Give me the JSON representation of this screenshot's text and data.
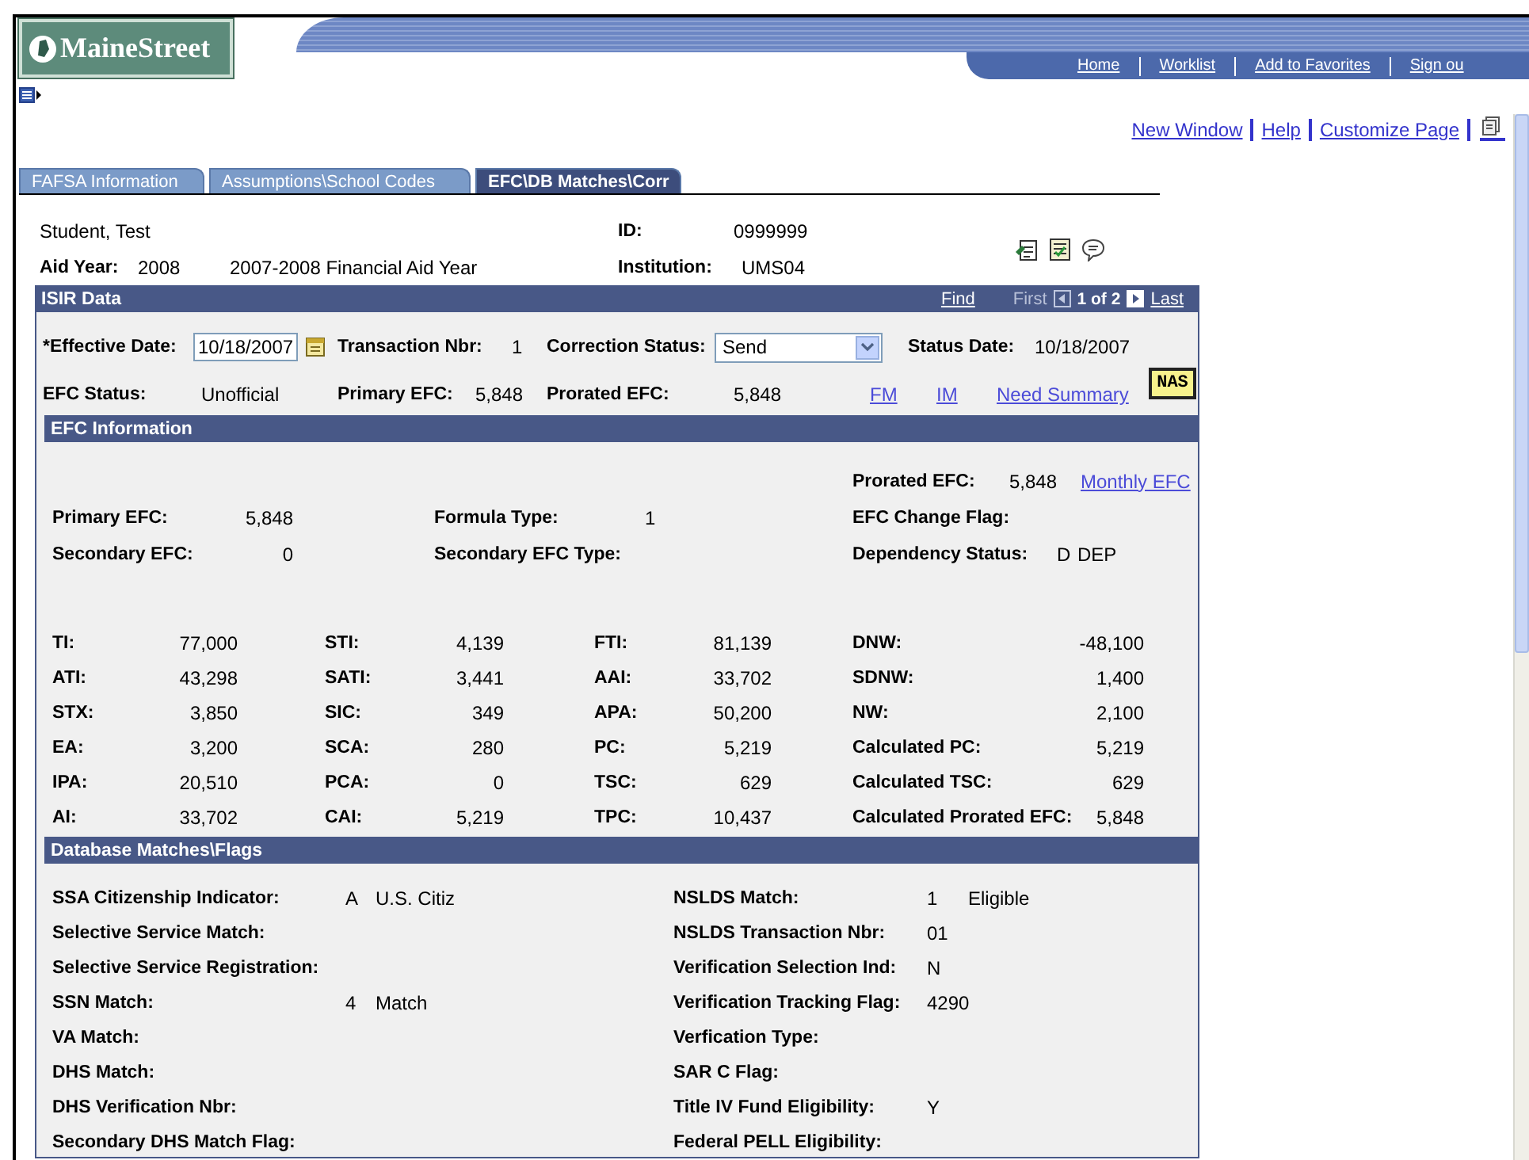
{
  "header": {
    "logo": "MaineStreet",
    "nav_links": [
      "Home",
      "Worklist",
      "Add to Favorites",
      "Sign ou"
    ]
  },
  "page_links": [
    "New Window",
    "Help",
    "Customize Page"
  ],
  "tabs": [
    {
      "label": "FAFSA Information",
      "selected": false
    },
    {
      "label": "Assumptions\\School Codes",
      "selected": false
    },
    {
      "label": "EFC\\DB Matches\\Corr",
      "selected": true
    }
  ],
  "student": {
    "name": "Student, Test",
    "id_label": "ID:",
    "id": "0999999",
    "aid_year_label": "Aid Year:",
    "aid_year": "2008",
    "aid_year_desc": "2007-2008 Financial Aid Year",
    "institution_label": "Institution:",
    "institution": "UMS04"
  },
  "isir": {
    "title": "ISIR Data",
    "find": "Find",
    "first": "First",
    "counter": "1 of 2",
    "last": "Last",
    "effective_date": {
      "label": "*Effective Date:",
      "value": "10/18/2007"
    },
    "transaction": {
      "label": "Transaction Nbr:",
      "value": "1"
    },
    "correction_status": {
      "label": "Correction Status:",
      "value": "Send"
    },
    "status_date": {
      "label": "Status Date:",
      "value": "10/18/2007"
    },
    "efc_status": {
      "label": "EFC Status:",
      "value": "Unofficial"
    },
    "primary_efc": {
      "label": "Primary EFC:",
      "value": "5,848"
    },
    "prorated_efc": {
      "label": "Prorated EFC:",
      "value": "5,848"
    },
    "links": [
      "FM",
      "IM",
      "Need Summary"
    ],
    "nas_button": "NAS"
  },
  "efc_information": {
    "title": "EFC Information",
    "prorated": {
      "label": "Prorated EFC:",
      "value": "5,848",
      "link": "Monthly EFC"
    },
    "summary_rows": [
      [
        {
          "label": "Primary EFC:",
          "value": "5,848"
        },
        {
          "label": "Formula Type:",
          "value": "1"
        },
        {
          "label": "EFC Change Flag:"
        }
      ],
      [
        {
          "label": "Secondary EFC:",
          "value": "0"
        },
        {
          "label": "Secondary EFC Type:"
        },
        {
          "label": "Dependency Status:",
          "value": "D",
          "description": "DEP"
        }
      ]
    ],
    "grid_rows": [
      [
        {
          "label": "TI:",
          "value": "77,000"
        },
        {
          "label": "STI:",
          "value": "4,139"
        },
        {
          "label": "FTI:",
          "value": "81,139"
        },
        {
          "label": "DNW:",
          "value": "-48,100"
        }
      ],
      [
        {
          "label": "ATI:",
          "value": "43,298"
        },
        {
          "label": "SATI:",
          "value": "3,441"
        },
        {
          "label": "AAI:",
          "value": "33,702"
        },
        {
          "label": "SDNW:",
          "value": "1,400"
        }
      ],
      [
        {
          "label": "STX:",
          "value": "3,850"
        },
        {
          "label": "SIC:",
          "value": "349"
        },
        {
          "label": "APA:",
          "value": "50,200"
        },
        {
          "label": "NW:",
          "value": "2,100"
        }
      ],
      [
        {
          "label": "EA:",
          "value": "3,200"
        },
        {
          "label": "SCA:",
          "value": "280"
        },
        {
          "label": "PC:",
          "value": "5,219"
        },
        {
          "label": "Calculated PC:",
          "value": "5,219"
        }
      ],
      [
        {
          "label": "IPA:",
          "value": "20,510"
        },
        {
          "label": "PCA:",
          "value": "0"
        },
        {
          "label": "TSC:",
          "value": "629"
        },
        {
          "label": "Calculated TSC:",
          "value": "629"
        }
      ],
      [
        {
          "label": "AI:",
          "value": "33,702"
        },
        {
          "label": "CAI:",
          "value": "5,219"
        },
        {
          "label": "TPC:",
          "value": "10,437"
        },
        {
          "label": "Calculated Prorated EFC:",
          "value": "5,848"
        }
      ]
    ]
  },
  "database_matches": {
    "title": "Database Matches\\Flags",
    "rows": [
      {
        "left": {
          "label": "SSA Citizenship Indicator:",
          "code": "A",
          "description": "U.S. Citiz"
        },
        "right": {
          "label": "NSLDS Match:",
          "code": "1",
          "description": "Eligible"
        }
      },
      {
        "left": {
          "label": "Selective Service Match:"
        },
        "right": {
          "label": "NSLDS Transaction Nbr:",
          "code": "01"
        }
      },
      {
        "left": {
          "label": "Selective Service Registration:"
        },
        "right": {
          "label": "Verification Selection Ind:",
          "code": "N"
        }
      },
      {
        "left": {
          "label": "SSN Match:",
          "code": "4",
          "description": "Match"
        },
        "right": {
          "label": "Verification Tracking Flag:",
          "code": "4290"
        }
      },
      {
        "left": {
          "label": "VA Match:"
        },
        "right": {
          "label": "Verfication Type:"
        }
      },
      {
        "left": {
          "label": "DHS Match:"
        },
        "right": {
          "label": "SAR C Flag:"
        }
      },
      {
        "left": {
          "label": "DHS Verification Nbr:"
        },
        "right": {
          "label": "Title IV Fund Eligibility:",
          "code": "Y"
        }
      },
      {
        "left": {
          "label": "Secondary DHS Match Flag:"
        },
        "right": {
          "label": "Federal PELL Eligibility:"
        }
      }
    ]
  }
}
